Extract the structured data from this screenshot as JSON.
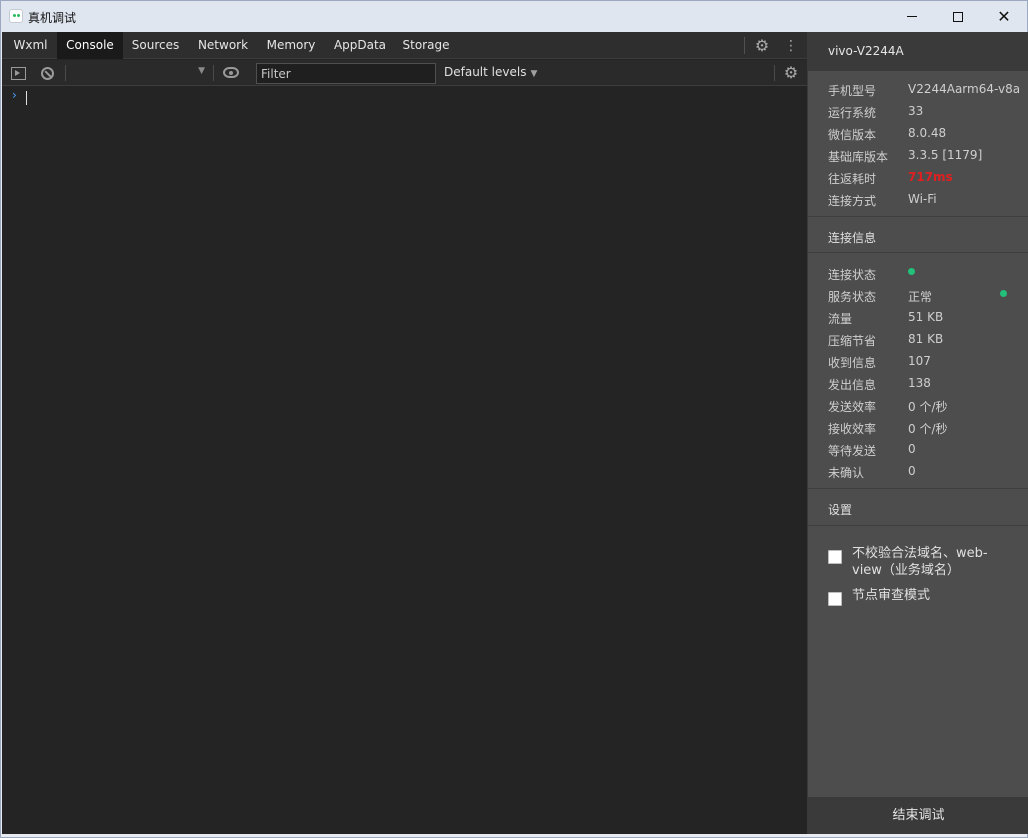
{
  "window": {
    "title": "真机调试",
    "controls": [
      "minimize-icon",
      "maximize-icon",
      "close-icon"
    ]
  },
  "tabs": [
    {
      "label": "Wxml",
      "active": false
    },
    {
      "label": "Console",
      "active": true
    },
    {
      "label": "Sources",
      "active": false
    },
    {
      "label": "Network",
      "active": false
    },
    {
      "label": "Memory",
      "active": false
    },
    {
      "label": "AppData",
      "active": false
    },
    {
      "label": "Storage",
      "active": false
    }
  ],
  "console_toolbar": {
    "filter_placeholder": "Filter",
    "levels_label": "Default levels"
  },
  "console": {
    "prompt": "›"
  },
  "panel": {
    "device_name": "vivo-V2244A",
    "device_info": [
      {
        "key": "手机型号",
        "value": "V2244Aarm64-v8a"
      },
      {
        "key": "运行系统",
        "value": "33"
      },
      {
        "key": "微信版本",
        "value": "8.0.48"
      },
      {
        "key": "基础库版本",
        "value": "3.3.5 [1179]"
      },
      {
        "key": "往返耗时",
        "value": "717ms"
      },
      {
        "key": "连接方式",
        "value": "Wi-Fi"
      }
    ],
    "connection_title": "连接信息",
    "connection": [
      {
        "key": "连接状态",
        "value": ""
      },
      {
        "key": "服务状态",
        "value": "正常"
      },
      {
        "key": "流量",
        "value": "51 KB"
      },
      {
        "key": "压缩节省",
        "value": "81 KB"
      },
      {
        "key": "收到信息",
        "value": "107"
      },
      {
        "key": "发出信息",
        "value": "138"
      },
      {
        "key": "发送效率",
        "value": "0 个/秒"
      },
      {
        "key": "接收效率",
        "value": "0 个/秒"
      },
      {
        "key": "等待发送",
        "value": "0"
      },
      {
        "key": "未确认",
        "value": "0"
      }
    ],
    "settings_title": "设置",
    "settings": [
      {
        "label": "不校验合法域名、web-view（业务域名）",
        "checked": false
      },
      {
        "label": "节点审查模式",
        "checked": false
      }
    ],
    "stop_label": "结束调试",
    "status_color": "#22c07a",
    "latency_color": "#e02020"
  }
}
